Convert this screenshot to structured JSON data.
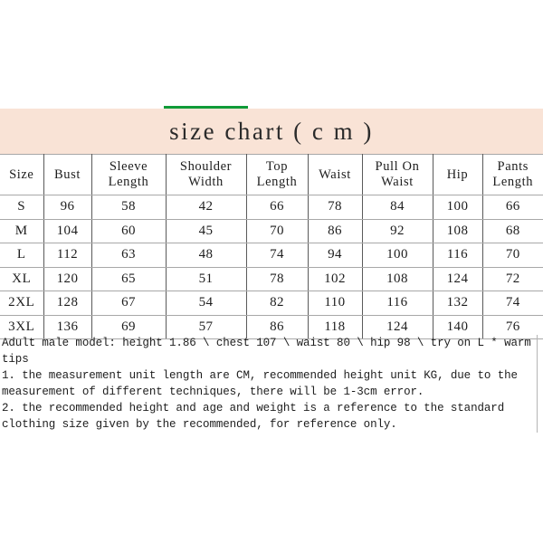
{
  "title": {
    "text": "size chart ( c m )",
    "band_color": "#f9e3d6",
    "accent_rule_color": "#0f9b38"
  },
  "table": {
    "columns": [
      "Size",
      "Bust",
      "Sleeve Length",
      "Shoulder Width",
      "Top Length",
      "Waist",
      "Pull On Waist",
      "Hip",
      "Pants Length"
    ],
    "column_lines": [
      [
        "Size",
        ""
      ],
      [
        "Bust",
        ""
      ],
      [
        "Sleeve",
        "Length"
      ],
      [
        "Shoulder",
        "Width"
      ],
      [
        "Top",
        "Length"
      ],
      [
        "Waist",
        ""
      ],
      [
        "Pull On",
        "Waist"
      ],
      [
        "Hip",
        ""
      ],
      [
        "Pants",
        "Length"
      ]
    ],
    "rows": [
      {
        "size": "S",
        "bust": "96",
        "sleeve_length": "58",
        "shoulder_width": "42",
        "top_length": "66",
        "waist": "78",
        "pull_on_waist": "84",
        "hip": "100",
        "pants_length": "66"
      },
      {
        "size": "M",
        "bust": "104",
        "sleeve_length": "60",
        "shoulder_width": "45",
        "top_length": "70",
        "waist": "86",
        "pull_on_waist": "92",
        "hip": "108",
        "pants_length": "68"
      },
      {
        "size": "L",
        "bust": "112",
        "sleeve_length": "63",
        "shoulder_width": "48",
        "top_length": "74",
        "waist": "94",
        "pull_on_waist": "100",
        "hip": "116",
        "pants_length": "70"
      },
      {
        "size": "XL",
        "bust": "120",
        "sleeve_length": "65",
        "shoulder_width": "51",
        "top_length": "78",
        "waist": "102",
        "pull_on_waist": "108",
        "hip": "124",
        "pants_length": "72"
      },
      {
        "size": "2XL",
        "bust": "128",
        "sleeve_length": "67",
        "shoulder_width": "54",
        "top_length": "82",
        "waist": "110",
        "pull_on_waist": "116",
        "hip": "132",
        "pants_length": "74"
      },
      {
        "size": "3XL",
        "bust": "136",
        "sleeve_length": "69",
        "shoulder_width": "57",
        "top_length": "86",
        "waist": "118",
        "pull_on_waist": "124",
        "hip": "140",
        "pants_length": "76"
      }
    ]
  },
  "notes": {
    "model": "Adult male model: height 1.86 \\ chest 107 \\ waist 80 \\ hip 98 \\ try on L * warm tips",
    "item1": "1. the measurement unit length are CM, recommended height unit KG, due to the measurement of different techniques, there will be 1-3cm error.",
    "item2": "2. the recommended height and age and weight is a reference to the standard clothing size given by the recommended, for reference only."
  }
}
